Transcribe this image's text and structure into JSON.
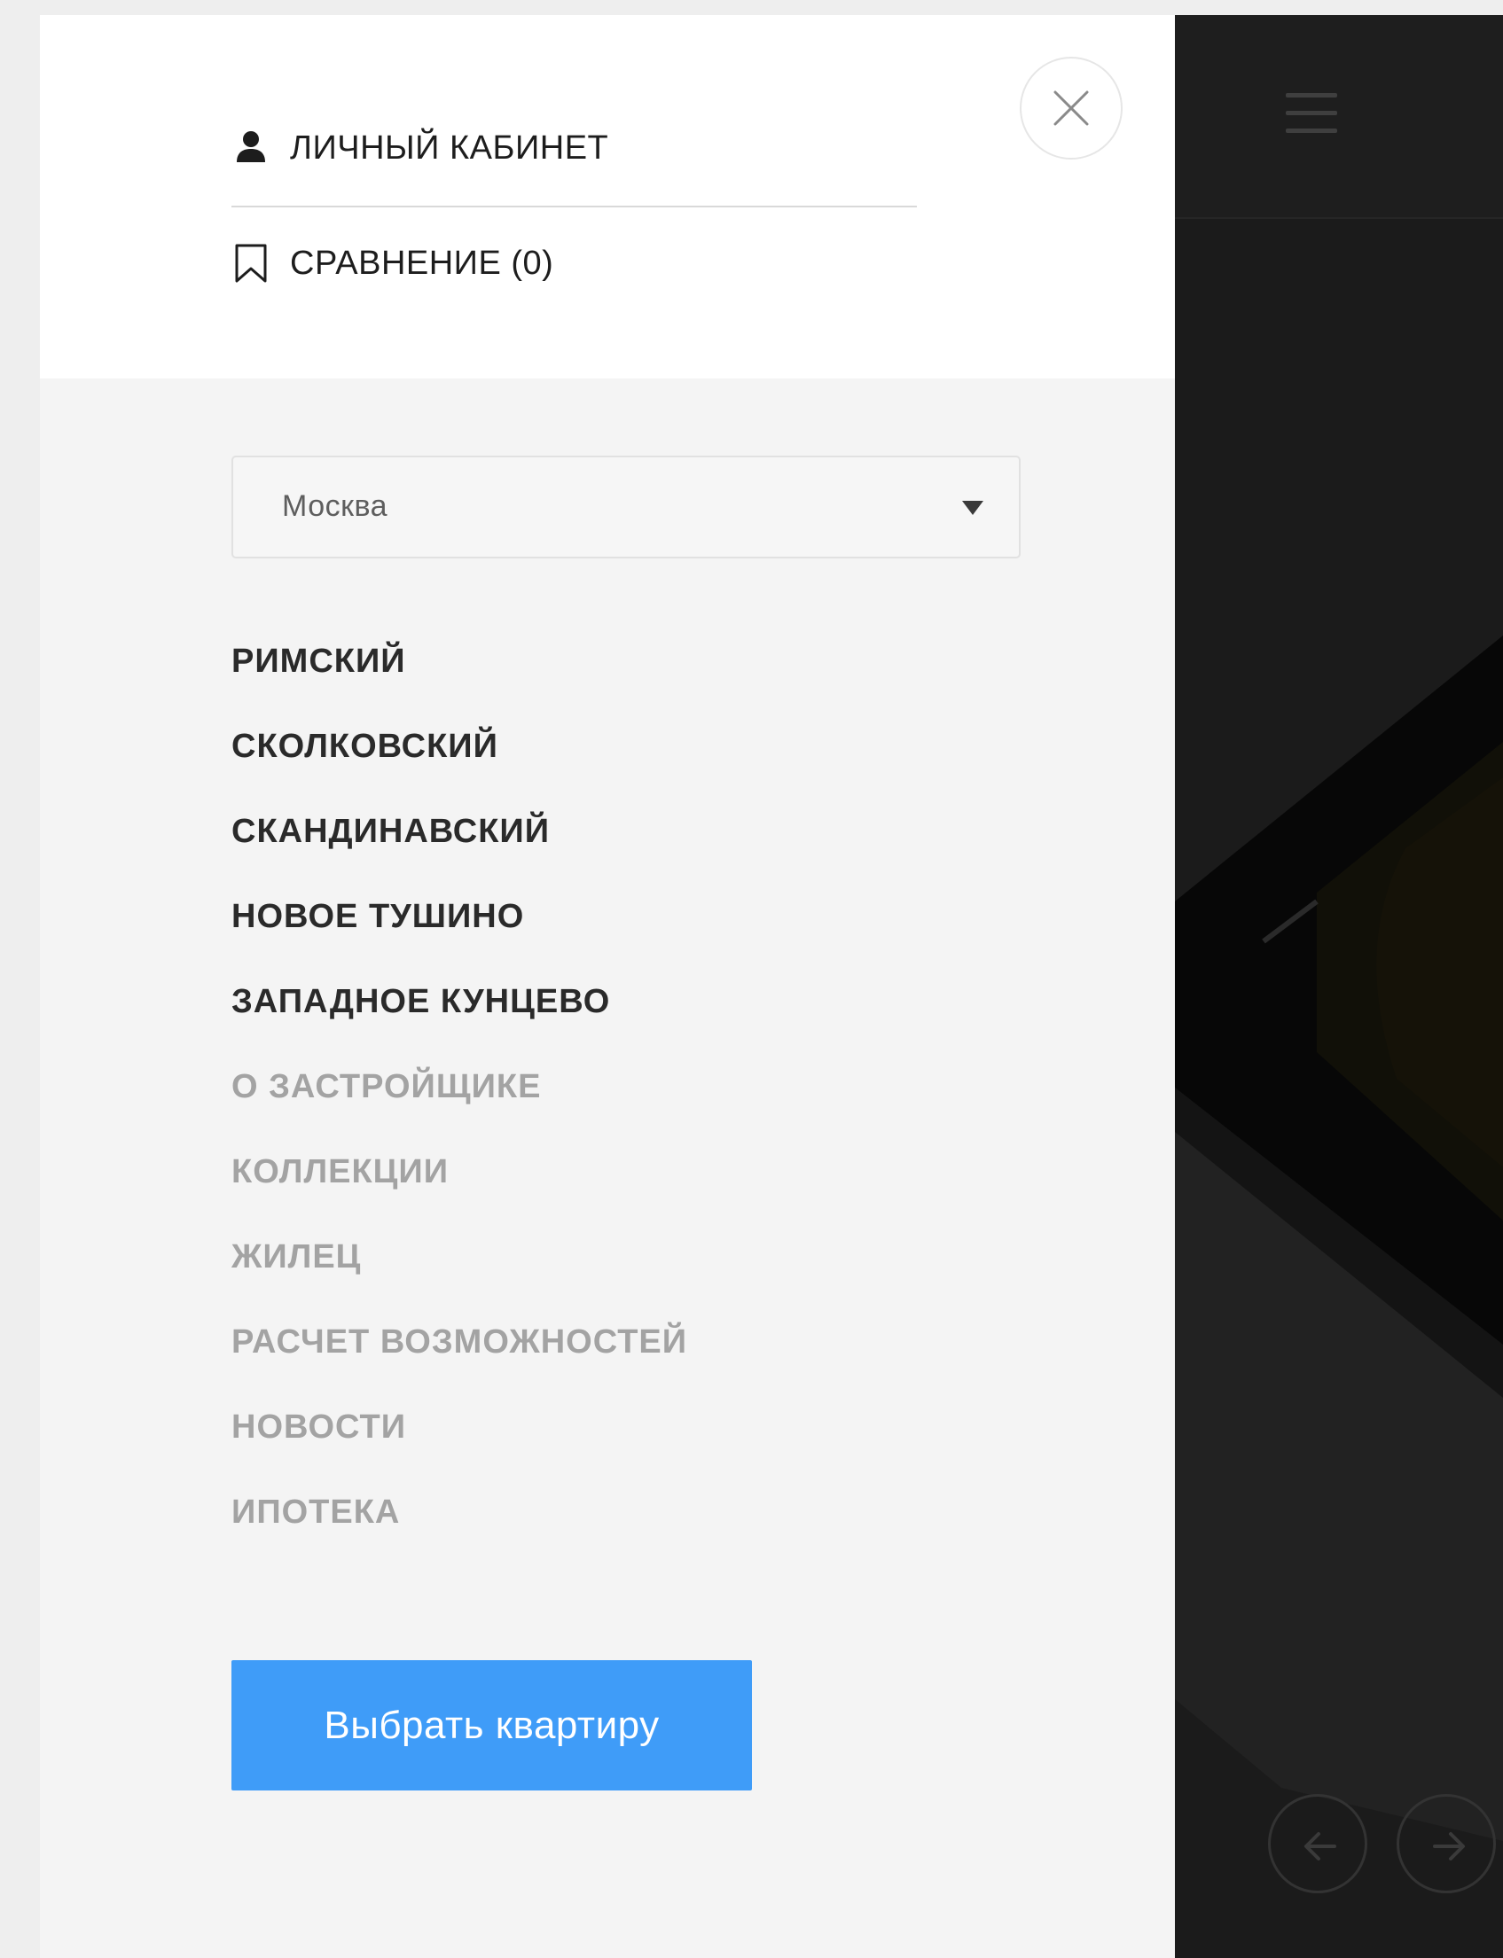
{
  "drawer": {
    "account_label": "ЛИЧНЫЙ КАБИНЕТ",
    "compare_label": "СРАВНЕНИЕ (0)",
    "city_select": {
      "selected": "Москва"
    },
    "nav_items": [
      {
        "label": "РИМСКИЙ",
        "style": "primary"
      },
      {
        "label": "СКОЛКОВСКИЙ",
        "style": "primary"
      },
      {
        "label": "СКАНДИНАВСКИЙ",
        "style": "primary"
      },
      {
        "label": "НОВОЕ ТУШИНО",
        "style": "primary"
      },
      {
        "label": "ЗАПАДНОЕ КУНЦЕВО",
        "style": "primary"
      },
      {
        "label": "О ЗАСТРОЙЩИКЕ",
        "style": "secondary"
      },
      {
        "label": "КОЛЛЕКЦИИ",
        "style": "secondary"
      },
      {
        "label": "ЖИЛЕЦ",
        "style": "secondary"
      },
      {
        "label": "РАСЧЕТ ВОЗМОЖНОСТЕЙ",
        "style": "secondary"
      },
      {
        "label": "НОВОСТИ",
        "style": "secondary"
      },
      {
        "label": "ИПОТЕКА",
        "style": "secondary"
      }
    ],
    "cta_label": "Выбрать квартиру"
  },
  "icons": {
    "account": "user-icon",
    "compare": "bookmark-icon",
    "close": "close-icon",
    "caret": "caret-down-icon",
    "menu": "hamburger-icon",
    "prev": "arrow-left-icon",
    "next": "arrow-right-icon"
  },
  "colors": {
    "accent": "#3f9cf8",
    "primary_text": "#2a2a2a",
    "secondary_text": "#a3a3a3",
    "drawer_bg": "#f4f4f4",
    "drawer_top_bg": "#ffffff",
    "page_bg": "#1c1c1c"
  }
}
